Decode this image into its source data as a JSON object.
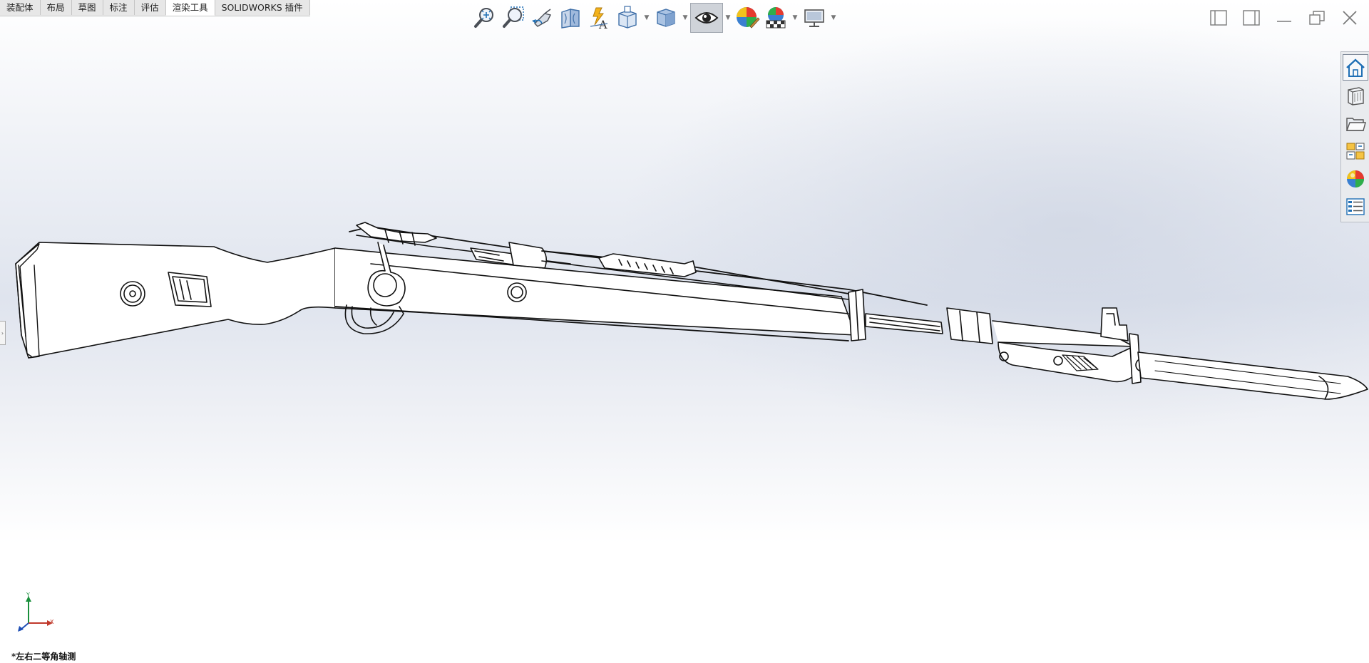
{
  "tabs": [
    {
      "label": "装配体"
    },
    {
      "label": "布局"
    },
    {
      "label": "草图"
    },
    {
      "label": "标注"
    },
    {
      "label": "评估"
    },
    {
      "label": "渲染工具",
      "active": true
    },
    {
      "label": "SOLIDWORKS 插件"
    }
  ],
  "hud_icons": [
    "zoom-to-fit-icon",
    "zoom-to-area-icon",
    "previous-view-icon",
    "section-view-icon",
    "dynamic-annotation-view-icon",
    "view-orientation-icon",
    "display-style-icon",
    "hide-show-items-icon",
    "edit-appearance-icon",
    "apply-scene-icon",
    "view-settings-icon"
  ],
  "window_controls": [
    "tile-left-icon",
    "tile-right-icon",
    "minimize-icon",
    "restore-icon",
    "close-icon"
  ],
  "task_pane_icons": [
    "solidworks-resources-icon",
    "design-library-icon",
    "file-explorer-icon",
    "view-palette-icon",
    "appearances-scenes-icon",
    "custom-properties-icon"
  ],
  "triad": {
    "x_label": "X",
    "y_label": "Y"
  },
  "view": {
    "name": "*左右二等角轴测"
  },
  "colors": {
    "accent_blue": "#1f6fb5",
    "tab_bar": "#e9e9e9",
    "model_edges": "#111111"
  }
}
